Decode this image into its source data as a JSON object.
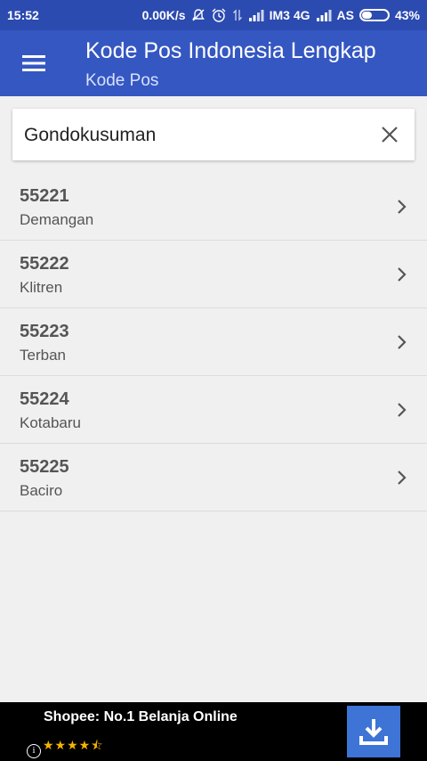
{
  "status_bar": {
    "time": "15:52",
    "speed": "0.00K/s",
    "carrier1": "IM3 4G",
    "carrier2": "AS",
    "battery_percent": "43%",
    "battery_level": 0.43
  },
  "app_bar": {
    "title": "Kode Pos Indonesia Lengkap",
    "subtitle": "Kode Pos",
    "menu_icon": "hamburger-menu-icon",
    "background": "#3557c2"
  },
  "search": {
    "value": "Gondokusuman",
    "clear_icon": "close-icon"
  },
  "results": [
    {
      "code": "55221",
      "name": "Demangan"
    },
    {
      "code": "55222",
      "name": "Klitren"
    },
    {
      "code": "55223",
      "name": "Terban"
    },
    {
      "code": "55224",
      "name": "Kotabaru"
    },
    {
      "code": "55225",
      "name": "Baciro"
    }
  ],
  "ad": {
    "title": "Shopee: No.1 Belanja Online",
    "stars": "★★★★⯪",
    "rating": 4.5,
    "info_icon": "i",
    "download_icon": "download-icon",
    "button_color": "#3d74d6"
  }
}
